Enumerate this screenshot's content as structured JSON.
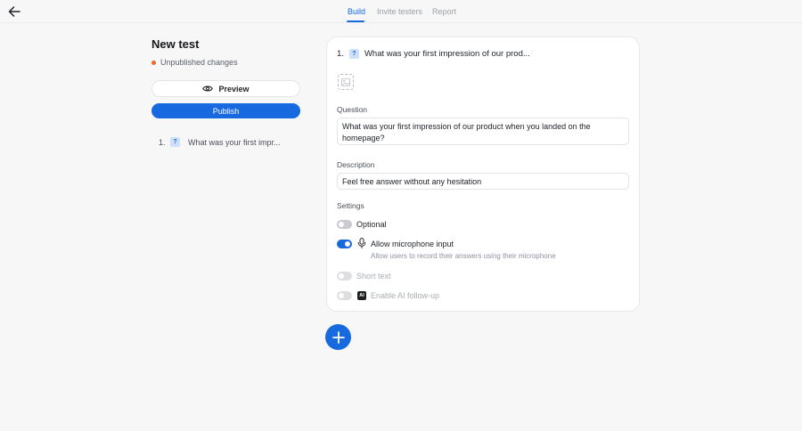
{
  "tabs": [
    {
      "label": "Build",
      "active": true
    },
    {
      "label": "Invite testers",
      "active": false
    },
    {
      "label": "Report",
      "active": false
    }
  ],
  "sidebar": {
    "title": "New test",
    "status": "Unpublished changes",
    "preview_label": "Preview",
    "publish_label": "Publish",
    "questions": [
      {
        "number": "1.",
        "badge": "?",
        "text": "What was your first impr..."
      }
    ]
  },
  "card": {
    "number": "1.",
    "badge": "?",
    "heading": "What was your first impression of our prod...",
    "question_label": "Question",
    "question_value": "What was your first impression of our product when you landed on the homepage?",
    "description_label": "Description",
    "description_value": "Feel free answer without any hesitation",
    "settings_label": "Settings",
    "settings": {
      "optional": {
        "label": "Optional",
        "on": false
      },
      "microphone": {
        "label": "Allow microphone input",
        "sub": "Allow users to record their answers using their microphone",
        "on": true
      },
      "short_text": {
        "label": "Short text",
        "on": false,
        "disabled": true
      },
      "ai_followup": {
        "label": "Enable AI follow-up",
        "icon_text": "AI",
        "on": false,
        "disabled": true
      }
    }
  },
  "colors": {
    "accent": "#1769e0",
    "status_dot": "#ea6a2a",
    "background": "#f7f7f8"
  },
  "icons": {
    "back": "arrow-left-icon",
    "preview": "eye-icon",
    "image": "image-placeholder-icon",
    "mic": "microphone-icon",
    "add": "plus-icon"
  }
}
